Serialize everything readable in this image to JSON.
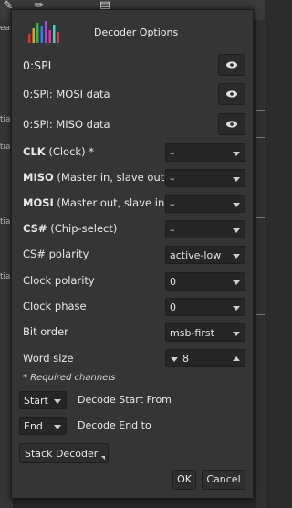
{
  "background": {
    "left_labels": [
      "eas",
      "tia",
      "tia",
      "tia",
      "tia"
    ]
  },
  "dialog": {
    "title": "Decoder Options",
    "channels": [
      {
        "label": "0:SPI"
      },
      {
        "label": "0:SPI: MOSI data"
      },
      {
        "label": "0:SPI: MISO data"
      }
    ],
    "options": {
      "clk": {
        "bold": "CLK",
        "rest": " (Clock) *",
        "value": "–"
      },
      "miso": {
        "bold": "MISO",
        "rest": " (Master in, slave out)",
        "value": "–"
      },
      "mosi": {
        "bold": "MOSI",
        "rest": " (Master out, slave in)",
        "value": "–"
      },
      "cs": {
        "bold": "CS#",
        "rest": " (Chip-select)",
        "value": "–"
      },
      "cs_polarity": {
        "label": "CS# polarity",
        "value": "active-low"
      },
      "clock_polarity": {
        "label": "Clock polarity",
        "value": "0"
      },
      "clock_phase": {
        "label": "Clock phase",
        "value": "0"
      },
      "bit_order": {
        "label": "Bit order",
        "value": "msb-first"
      },
      "word_size": {
        "label": "Word size",
        "value": "8"
      }
    },
    "hint": "* Required channels",
    "start": {
      "value": "Start",
      "label": "Decode Start From"
    },
    "end": {
      "value": "End",
      "label": "Decode End to"
    },
    "stack_button": "Stack Decoder",
    "ok_button": "OK",
    "cancel_button": "Cancel",
    "colors": {
      "logo_bars": [
        "#d43a3a",
        "#e0a030",
        "#3ab04a",
        "#3a7ad4",
        "#9a4ad4",
        "#d43a9a",
        "#3ad4c8"
      ]
    }
  }
}
